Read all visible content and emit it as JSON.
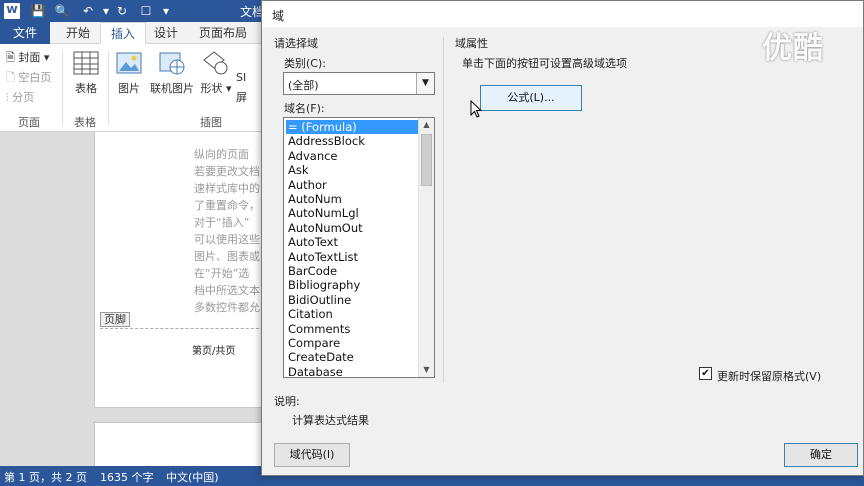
{
  "word": {
    "logo": "W",
    "doc_title": "文档",
    "tabs": [
      "文件",
      "开始",
      "插入",
      "设计",
      "页面布局"
    ],
    "ribbon": {
      "pages_group": {
        "cover": "封面",
        "blank": "空白页",
        "break": "分页",
        "label": "页面"
      },
      "tables_group": {
        "table": "表格",
        "label": "表格"
      },
      "illustrations_group": {
        "picture": "图片",
        "online_picture": "联机图片",
        "shapes": "形状",
        "label": "插图"
      },
      "extra_small_1": "SI",
      "extra_small_2": "屏"
    },
    "document_lines": [
      "纵向的页面",
      "若要更改文档",
      "速样式库中的",
      "了重置命令，",
      "对于“插入”",
      "可以使用这些",
      "图片、图表或",
      "在“开始”选",
      "档中所选文本",
      "多数控件都允"
    ],
    "footer_tag": "页脚",
    "footer_text": "第页/共页"
  },
  "statusbar": {
    "page": "第 1 页，共 2 页",
    "words": "1635 个字",
    "language": "中文(中国)"
  },
  "dialog": {
    "title": "域",
    "watermark": "优酷",
    "choose_field": "请选择域",
    "category_label": "类别(C):",
    "category_value": "(全部)",
    "field_names_label": "域名(F):",
    "fields": [
      "= (Formula)",
      "AddressBlock",
      "Advance",
      "Ask",
      "Author",
      "AutoNum",
      "AutoNumLgl",
      "AutoNumOut",
      "AutoText",
      "AutoTextList",
      "BarCode",
      "Bibliography",
      "BidiOutline",
      "Citation",
      "Comments",
      "Compare",
      "CreateDate",
      "Database"
    ],
    "selected_field": "= (Formula)",
    "field_properties": "域属性",
    "properties_hint": "单击下面的按钮可设置高级域选项",
    "formula_button": "公式(L)...",
    "preserve_label": "更新时保留原格式(V)",
    "preserve_checked": true,
    "description_label": "说明:",
    "description_text": "计算表达式结果",
    "field_codes_button": "域代码(I)",
    "ok_button": "确定"
  }
}
